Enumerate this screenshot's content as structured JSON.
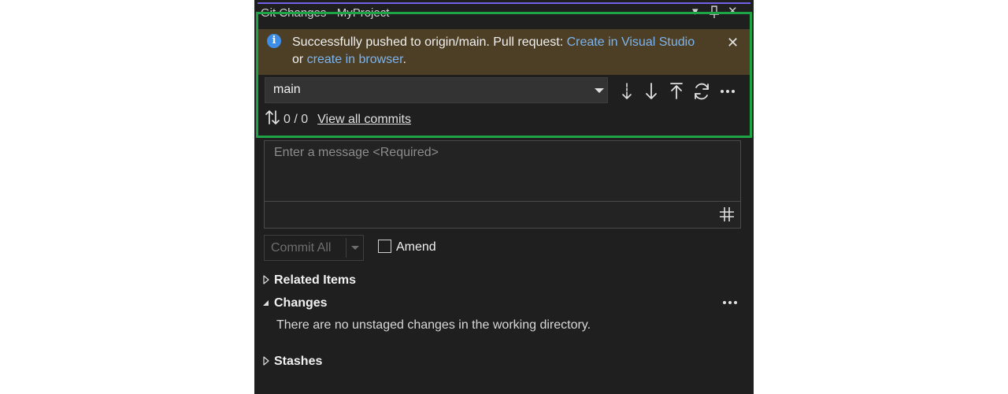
{
  "window": {
    "title": "Git Changes - MyProject"
  },
  "notification": {
    "text_prefix": "Successfully pushed to origin/main. Pull request: ",
    "link_visual_studio": "Create in Visual Studio",
    "text_or": " or ",
    "link_browser": "create in browser",
    "text_suffix": "."
  },
  "branch": {
    "selected": "main"
  },
  "commits": {
    "count": "0 / 0",
    "view_all_label": "View all commits"
  },
  "message": {
    "placeholder": "Enter a message <Required>"
  },
  "commit": {
    "button_label": "Commit All",
    "amend_label": "Amend"
  },
  "sections": {
    "related_items": "Related Items",
    "changes": "Changes",
    "changes_empty": "There are no unstaged changes in the working directory.",
    "stashes": "Stashes"
  },
  "colors": {
    "accent_highlight": "#1ea446",
    "info_bar": "#4d3f25",
    "link": "#7cb4ef",
    "panel_bg": "#1f1f1f"
  },
  "icons": [
    "info-icon",
    "close-icon",
    "chevron-down-icon",
    "fetch-icon",
    "pull-icon",
    "push-icon",
    "sync-icon",
    "more-icon",
    "incoming-outgoing-icon",
    "hash-icon",
    "checkbox-icon",
    "expand-triangle-icon",
    "collapse-triangle-icon"
  ]
}
